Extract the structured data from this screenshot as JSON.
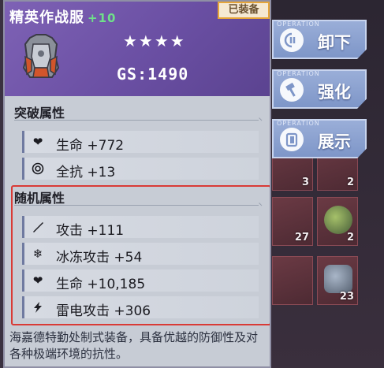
{
  "item": {
    "name": "精英作战服",
    "level": "+10",
    "equipped_badge": "已装备",
    "stars": "★★★★",
    "gs": "GS:1490"
  },
  "sections": {
    "breakthrough_title": "突破属性",
    "random_title": "随机属性"
  },
  "breakthrough_stats": [
    {
      "icon": "heart-icon",
      "label": "生命",
      "value": "+772"
    },
    {
      "icon": "resist-all-icon",
      "label": "全抗",
      "value": "+13"
    }
  ],
  "random_stats": [
    {
      "icon": "sword-icon",
      "label": "攻击",
      "value": "+111"
    },
    {
      "icon": "snowflake-icon",
      "label": "冰冻攻击",
      "value": "+54"
    },
    {
      "icon": "heart-icon",
      "label": "生命",
      "value": "+10,185"
    },
    {
      "icon": "lightning-icon",
      "label": "雷电攻击",
      "value": "+306"
    }
  ],
  "description": "海嘉德特勤处制式装备，具备优越的防御性及对各种极端环境的抗性。",
  "operations": [
    {
      "tag": "OPERATION",
      "label": "卸下",
      "icon": "unequip-icon"
    },
    {
      "tag": "OPERATION",
      "label": "强化",
      "icon": "hammer-icon"
    },
    {
      "tag": "OPERATION",
      "label": "展示",
      "icon": "display-icon"
    }
  ],
  "background_slots": [
    "3",
    "2",
    "27",
    "2",
    "23"
  ]
}
